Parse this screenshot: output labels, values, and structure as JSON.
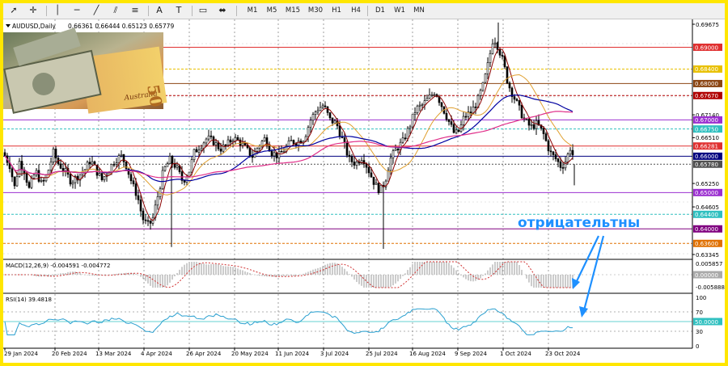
{
  "toolbar": {
    "tools": [
      {
        "name": "cursor-icon",
        "glyph": "➚"
      },
      {
        "name": "crosshair-icon",
        "glyph": "✛"
      },
      {
        "name": "vertical-line-icon",
        "glyph": "│"
      },
      {
        "name": "horizontal-line-icon",
        "glyph": "─"
      },
      {
        "name": "trendline-icon",
        "glyph": "╱"
      },
      {
        "name": "equidistant-channel-icon",
        "glyph": "⫽"
      },
      {
        "name": "fibonacci-icon",
        "glyph": "≡"
      },
      {
        "name": "text-icon",
        "glyph": "A"
      },
      {
        "name": "text-label-icon",
        "glyph": "T"
      },
      {
        "name": "rectangle-icon",
        "glyph": "▭"
      },
      {
        "name": "shapes-dropdown-icon",
        "glyph": "⬌"
      }
    ],
    "timeframes": [
      "M1",
      "M5",
      "M15",
      "M30",
      "H1",
      "H4",
      "D1",
      "W1",
      "MN"
    ]
  },
  "chart": {
    "title": "AUDUSD,Daily",
    "ohlc": "0.66361 0.66444 0.65123 0.65779",
    "annotation": "отрицательтны",
    "price_labels": [
      {
        "text": "0.69675",
        "color": "#000000",
        "boxed": false
      },
      {
        "text": "0.69000",
        "color": "#e03030",
        "boxed": true
      },
      {
        "text": "0.68400",
        "color": "#e8c000",
        "boxed": true
      },
      {
        "text": "0.68000",
        "color": "#8b4513",
        "boxed": true
      },
      {
        "text": "0.67670",
        "color": "#b00000",
        "boxed": true
      },
      {
        "text": "0.67140",
        "color": "#000000",
        "boxed": false
      },
      {
        "text": "0.67000",
        "color": "#9b30d0",
        "boxed": true
      },
      {
        "text": "0.66750",
        "color": "#30c0c0",
        "boxed": true
      },
      {
        "text": "0.66510",
        "color": "#000000",
        "boxed": false
      },
      {
        "text": "0.66281",
        "color": "#e03030",
        "boxed": true
      },
      {
        "text": "0.66000",
        "color": "#000080",
        "boxed": true
      },
      {
        "text": "0.65780",
        "color": "#505050",
        "boxed": true
      },
      {
        "text": "0.65250",
        "color": "#000000",
        "boxed": false
      },
      {
        "text": "0.65000",
        "color": "#9b30d0",
        "boxed": true
      },
      {
        "text": "0.64605",
        "color": "#000000",
        "boxed": false
      },
      {
        "text": "0.64400",
        "color": "#30c0c0",
        "boxed": true
      },
      {
        "text": "0.64000",
        "color": "#800080",
        "boxed": true
      },
      {
        "text": "0.63600",
        "color": "#e07000",
        "boxed": true
      },
      {
        "text": "0.63345",
        "color": "#000000",
        "boxed": false
      }
    ],
    "date_labels": [
      "29 Jan 2024",
      "20 Feb 2024",
      "13 Mar 2024",
      "4 Apr 2024",
      "26 Apr 2024",
      "20 May 2024",
      "11 Jun 2024",
      "3 Jul 2024",
      "25 Jul 2024",
      "16 Aug 2024",
      "9 Sep 2024",
      "1 Oct 2024",
      "23 Oct 2024"
    ]
  },
  "macd": {
    "title": "MACD(12,26,9) -0.004591 -0.004772",
    "labels": [
      "0.005857",
      "0.00000",
      "-0.005888"
    ]
  },
  "rsi": {
    "title": "RSI(14) 39.4818",
    "labels": [
      "100",
      "70",
      "50.0000",
      "30",
      "0"
    ]
  },
  "colors": {
    "frame": "#ffe600",
    "annotation": "#1e90ff",
    "ma_fast": "#8b0000",
    "ma_mid": "#e0a030",
    "ma_slow": "#0000a0",
    "ma_200": "#e0308a",
    "rsi_line": "#2aa0d0"
  }
}
